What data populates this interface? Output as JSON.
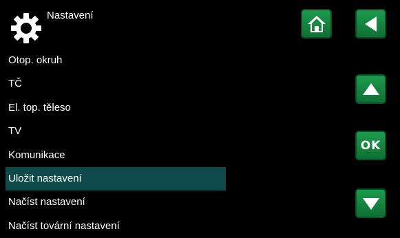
{
  "header": {
    "title": "Nastavení",
    "icon": "gear-icon"
  },
  "menu": {
    "items": [
      {
        "label": "Otop. okruh"
      },
      {
        "label": "TČ"
      },
      {
        "label": "El. top. těleso"
      },
      {
        "label": "TV"
      },
      {
        "label": "Komunikace"
      },
      {
        "label": "Uložit nastavení",
        "selected": true
      },
      {
        "label": "Načíst nastavení"
      },
      {
        "label": "Načíst tovární nastavení"
      }
    ]
  },
  "buttons": {
    "home_icon": "home-icon",
    "back_icon": "back-arrow-icon",
    "up_icon": "arrow-up-icon",
    "ok_label": "OK",
    "down_icon": "arrow-down-icon"
  },
  "colors": {
    "background": "#000000",
    "selected_row": "#0e4a4a",
    "button_green": "#1e9a4e"
  }
}
